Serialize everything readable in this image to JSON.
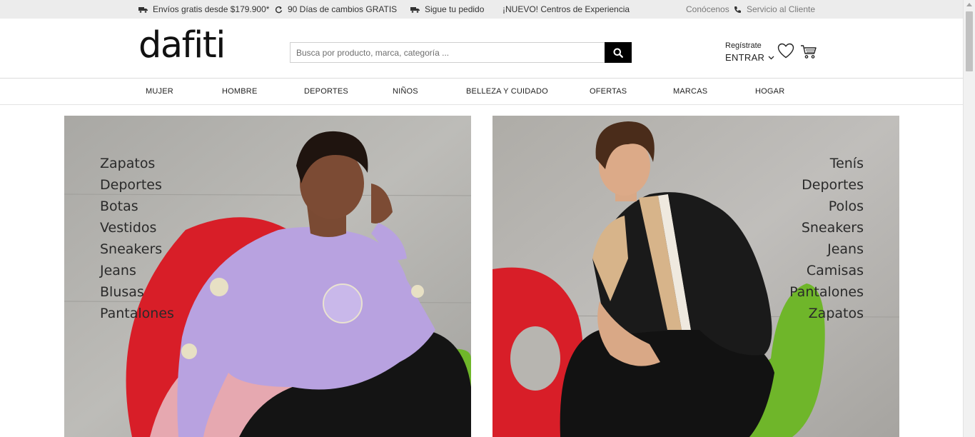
{
  "topbar": {
    "shipping": "Envíos gratis desde $179.900*",
    "returns": "90 Días de cambios GRATIS",
    "tracking": "Sigue tu pedido",
    "experience": "¡NUEVO! Centros de Experiencia",
    "about": "Conócenos",
    "service": "Servicio al Cliente"
  },
  "header": {
    "logo": "dafiti",
    "search_placeholder": "Busca por producto, marca, categoría ...",
    "register": "Regístrate",
    "login": "ENTRAR"
  },
  "nav": [
    "MUJER",
    "HOMBRE",
    "DEPORTES",
    "NIÑOS",
    "BELLEZA Y CUIDADO",
    "OFERTAS",
    "MARCAS",
    "HOGAR"
  ],
  "banners": {
    "women": [
      "Zapatos",
      "Deportes",
      "Botas",
      "Vestidos",
      "Sneakers",
      "Jeans",
      "Blusas",
      "Pantalones"
    ],
    "men": [
      "Tenís",
      "Deportes",
      "Polos",
      "Sneakers",
      "Jeans",
      "Camisas",
      "Pantalones",
      "Zapatos"
    ]
  },
  "colors": {
    "topbar_bg": "#ececec",
    "search_button": "#000000",
    "sweater": "#b8a2e0",
    "chair_red": "#d81e28",
    "chair_green": "#6fb62a"
  }
}
